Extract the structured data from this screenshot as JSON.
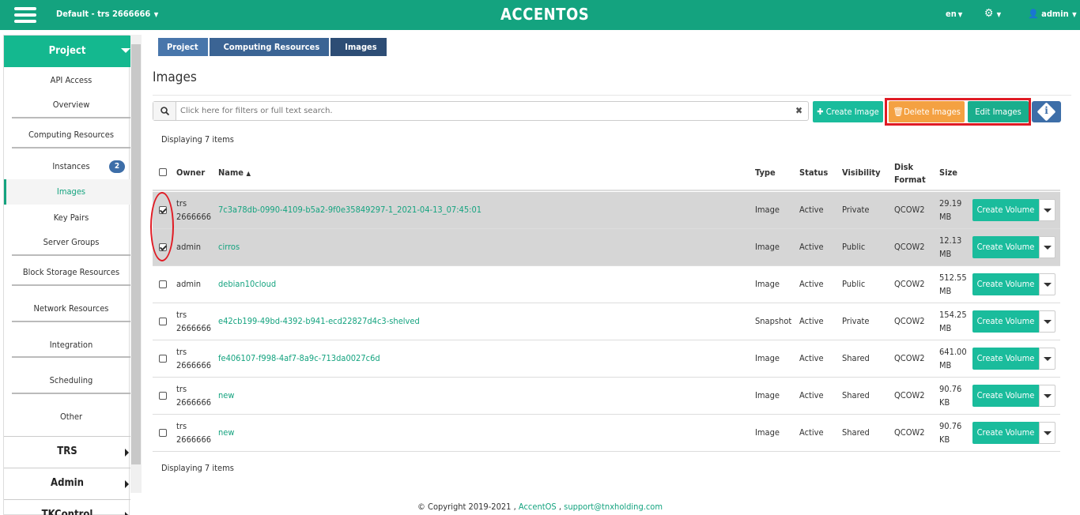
{
  "header": {
    "project_selector": "Default - trs 2666666",
    "brand": "ACCENTOS",
    "language": "en",
    "user": "admin"
  },
  "sidebar": {
    "project": "Project",
    "items": [
      {
        "label": "API Access"
      },
      {
        "label": "Overview"
      },
      {
        "label": "Computing Resources"
      },
      {
        "label": "Instances",
        "badge": "2"
      },
      {
        "label": "Images",
        "active": true
      },
      {
        "label": "Key Pairs"
      },
      {
        "label": "Server Groups"
      },
      {
        "label": "Block Storage Resources"
      },
      {
        "label": "Network Resources"
      },
      {
        "label": "Integration"
      },
      {
        "label": "Scheduling"
      },
      {
        "label": "Other"
      }
    ],
    "groups": [
      "TRS",
      "Admin",
      "TKControl"
    ]
  },
  "breadcrumb": [
    "Project",
    "Computing Resources",
    "Images"
  ],
  "page_title": "Images",
  "search": {
    "placeholder": "Click here for filters or full text search."
  },
  "toolbar": {
    "create_label": "Create Image",
    "delete_label": "Delete Images",
    "edit_label": "Edit Images"
  },
  "display_count": "Displaying 7 items",
  "table": {
    "headers": [
      "Owner",
      "Name",
      "Type",
      "Status",
      "Visibility",
      "Disk Format",
      "Size"
    ],
    "sorted_column": "Name",
    "action_label": "Create Volume",
    "rows": [
      {
        "checked": true,
        "owner": "trs 2666666",
        "name": "7c3a78db-0990-4109-b5a2-9f0e35849297-1_2021-04-13_07:45:01",
        "type": "Image",
        "status": "Active",
        "visibility": "Private",
        "format": "QCOW2",
        "size": "29.19 MB"
      },
      {
        "checked": true,
        "owner": "admin",
        "name": "cirros",
        "type": "Image",
        "status": "Active",
        "visibility": "Public",
        "format": "QCOW2",
        "size": "12.13 MB"
      },
      {
        "checked": false,
        "owner": "admin",
        "name": "debian10cloud",
        "type": "Image",
        "status": "Active",
        "visibility": "Public",
        "format": "QCOW2",
        "size": "512.55 MB"
      },
      {
        "checked": false,
        "owner": "trs 2666666",
        "name": "e42cb199-49bd-4392-b941-ecd22827d4c3-shelved",
        "type": "Snapshot",
        "status": "Active",
        "visibility": "Private",
        "format": "QCOW2",
        "size": "154.25 MB"
      },
      {
        "checked": false,
        "owner": "trs 2666666",
        "name": "fe406107-f998-4af7-8a9c-713da0027c6d",
        "type": "Image",
        "status": "Active",
        "visibility": "Shared",
        "format": "QCOW2",
        "size": "641.00 MB"
      },
      {
        "checked": false,
        "owner": "trs 2666666",
        "name": "new",
        "type": "Image",
        "status": "Active",
        "visibility": "Shared",
        "format": "QCOW2",
        "size": "90.76 KB"
      },
      {
        "checked": false,
        "owner": "trs 2666666",
        "name": "new",
        "type": "Image",
        "status": "Active",
        "visibility": "Shared",
        "format": "QCOW2",
        "size": "90.76 KB"
      }
    ]
  },
  "footer": {
    "copyright": "© Copyright 2019-2021 ,",
    "brand_link": "AccentOS",
    "sep": ",",
    "email": "support@tnxholding.com"
  }
}
